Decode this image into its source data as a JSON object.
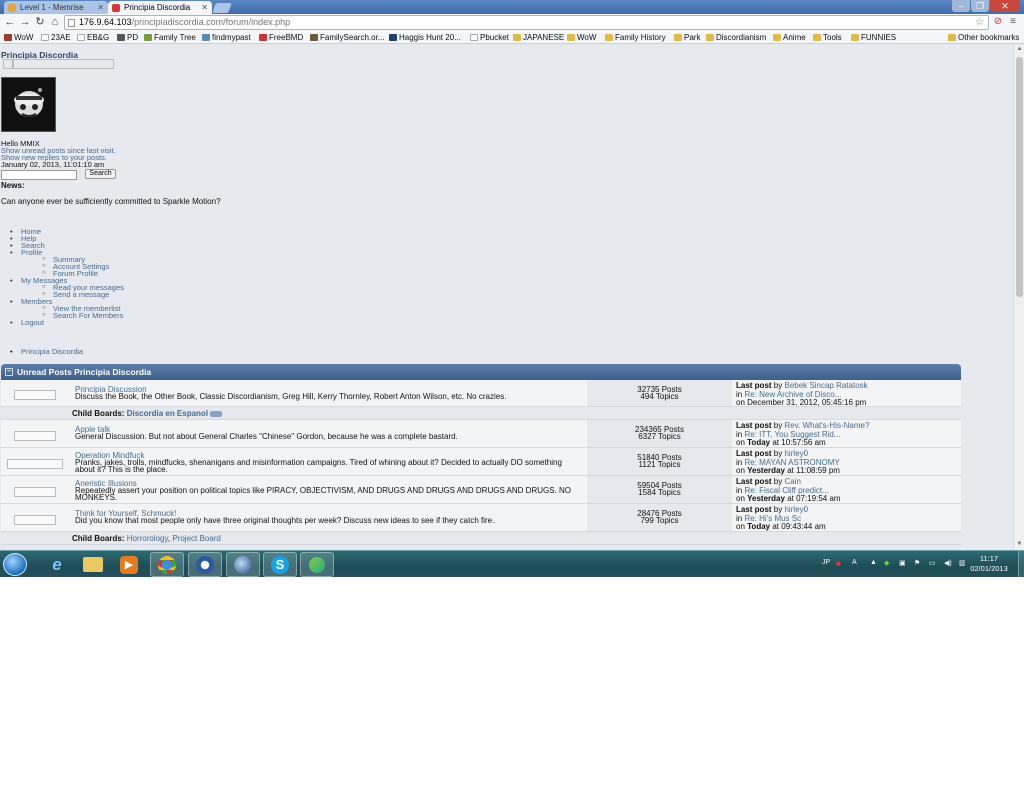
{
  "browser": {
    "tabs": [
      {
        "label": "Level 1 - Memrise",
        "active": false
      },
      {
        "label": "Principia Discordia",
        "active": true
      }
    ],
    "url_host": "176.9.64.103",
    "url_path": "/principiadiscordia.com/forum/index.php",
    "bookmarks": [
      {
        "label": "WoW",
        "icon": "wow-icon"
      },
      {
        "label": "23AE",
        "icon": "page-icon"
      },
      {
        "label": "EB&G",
        "icon": "page-icon"
      },
      {
        "label": "PD",
        "icon": "pd-icon"
      },
      {
        "label": "Family Tree",
        "icon": "tree-icon"
      },
      {
        "label": "findmypast",
        "icon": "fmp-icon"
      },
      {
        "label": "FreeBMD",
        "icon": "bmd-icon"
      },
      {
        "label": "FamilySearch.or...",
        "icon": "familysearch-icon"
      },
      {
        "label": "Haggis Hunt 20...",
        "icon": "haggis-icon"
      },
      {
        "label": "Pbucket",
        "icon": "photobucket-icon"
      },
      {
        "label": "JAPANESE",
        "icon": "folder-icon"
      },
      {
        "label": "WoW",
        "icon": "folder-icon"
      },
      {
        "label": "Family History",
        "icon": "folder-icon"
      },
      {
        "label": "Park",
        "icon": "folder-icon"
      },
      {
        "label": "Discordianism",
        "icon": "folder-icon"
      },
      {
        "label": "Anime",
        "icon": "folder-icon"
      },
      {
        "label": "Tools",
        "icon": "folder-icon"
      },
      {
        "label": "FUNNIES",
        "icon": "folder-icon"
      }
    ],
    "other_bookmarks": "Other bookmarks"
  },
  "forum": {
    "title": "Principia Discordia",
    "greeting": "Hello MMIX",
    "unread_link": "Show unread posts since last visit.",
    "replies_link": "Show new replies to your posts.",
    "date": "January 02, 2013, 11:01:10 am",
    "search_button": "Search",
    "news_label": "News:",
    "news_text": "Can anyone ever be sufficiently committed to Sparkle Motion?",
    "menu": [
      {
        "label": "Home"
      },
      {
        "label": "Help"
      },
      {
        "label": "Search"
      },
      {
        "label": "Profile",
        "children": [
          "Summary",
          "Account Settings",
          "Forum Profile"
        ]
      },
      {
        "label": "My Messages",
        "children": [
          "Read your messages",
          "Send a message"
        ]
      },
      {
        "label": "Members",
        "children": [
          "View the memberlist",
          "Search For Members"
        ]
      },
      {
        "label": "Logout"
      }
    ],
    "breadcrumb": "Principia Discordia",
    "category": "Unread Posts Principia Discordia",
    "child_boards_label": "Child Boards:",
    "last_post_label": "Last post",
    "by_label": "by",
    "in_label": "in",
    "on_label": "on",
    "boards": [
      {
        "name": "Principia Discussion",
        "description": "Discuss the Book, the Other Book, Classic Discordianism, Greg Hill, Kerry Thornley, Robert Anton Wilson, etc. No crazies.",
        "posts": "32735 Posts",
        "topics": "494 Topics",
        "last_by": "Bebek Sincap Ratatosk",
        "last_in": "Re: New Archive of Disco...",
        "last_when_bold": "",
        "last_when": "December 31, 2012, 05:45:16 pm",
        "child_boards": [
          "Discordia en Espanol"
        ],
        "child_new": true
      },
      {
        "name": "Apple talk",
        "description": "General Discussion. But not about General Charles \"Chinese\" Gordon, because he was a complete bastard.",
        "posts": "234365 Posts",
        "topics": "6327 Topics",
        "last_by": "Rev. What's-His-Name?",
        "last_in": "Re: ITT, You Suggest Rid...",
        "last_when_bold": "Today",
        "last_when": "at 10:57:56 am",
        "child_boards": []
      },
      {
        "name": "Operation Mindfuck",
        "description": "Pranks, jakes, trolls, mindfucks, shenanigans and misinformation campaigns. Tired of whining about it? Decided to actually DO something about it? This is the place.",
        "posts": "51840 Posts",
        "topics": "1121 Topics",
        "last_by": "hirley0",
        "last_in": "Re: MAYAN ASTRONOMY",
        "last_when_bold": "Yesterday",
        "last_when": "at 11:08:59 pm",
        "child_boards": []
      },
      {
        "name": "Aneristic Illusions",
        "description": "Repeatedly assert your position on political topics like PIRACY, OBJECTIVISM, AND DRUGS AND DRUGS AND DRUGS AND DRUGS. NO MONKEYS.",
        "posts": "59504 Posts",
        "topics": "1584 Topics",
        "last_by": "Cain",
        "last_in": "Re: Fiscal Cliff predict...",
        "last_when_bold": "Yesterday",
        "last_when": "at 07:19:54 am",
        "child_boards": []
      },
      {
        "name": "Think for Yourself, Schmuck!",
        "description": "Did you know that most people only have three original thoughts per week? Discuss new ideas to see if they catch fire.",
        "posts": "28476 Posts",
        "topics": "799 Topics",
        "last_by": "hirley0",
        "last_in": "Re: Hi's Mus Sc",
        "last_when_bold": "Today",
        "last_when": "at 09:43:44 am",
        "child_boards": [
          "Horrorology",
          "Project Board"
        ]
      }
    ]
  },
  "taskbar": {
    "apps": [
      {
        "name": "ie-icon",
        "active": false
      },
      {
        "name": "explorer-icon",
        "active": false
      },
      {
        "name": "media-player-icon",
        "active": false
      },
      {
        "name": "chrome-icon",
        "active": true
      },
      {
        "name": "thunderbird-icon",
        "active": true
      },
      {
        "name": "app-icon",
        "active": true
      },
      {
        "name": "skype-icon",
        "active": true
      },
      {
        "name": "messenger-icon",
        "active": true
      }
    ],
    "lang": "JP",
    "time": "11:17",
    "date": "02/01/2013"
  }
}
